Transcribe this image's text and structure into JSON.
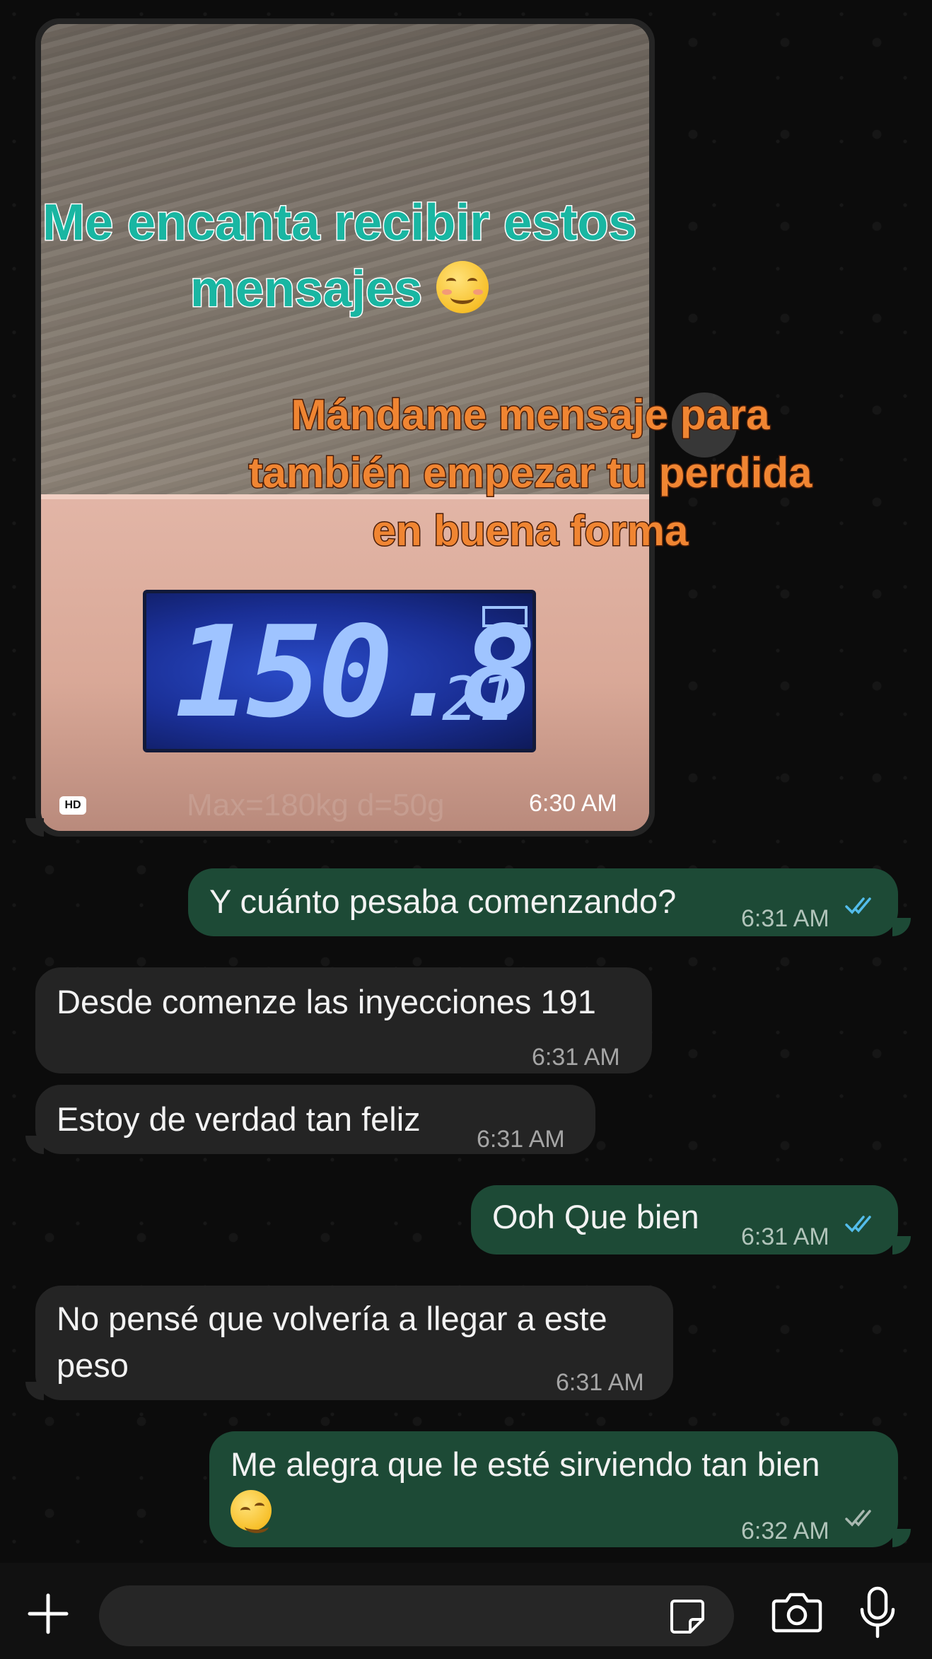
{
  "media_message": {
    "overlay_teal_line1": "Me encanta recibir estos",
    "overlay_teal_line2": "mensajes",
    "overlay_orange_line1": "Mándame mensaje para",
    "overlay_orange_line2": "también empezar tu perdida",
    "overlay_orange_line3": "en buena forma",
    "scale_reading": "150.8",
    "scale_small_reading": "21",
    "scale_label": "Max=180kg d=50g",
    "hd_badge": "HD",
    "time": "6:30 AM"
  },
  "messages": [
    {
      "direction": "out",
      "text": "Y cuánto pesaba comenzando?",
      "time": "6:31 AM",
      "status": "read"
    },
    {
      "direction": "in",
      "text": "Desde comenze las inyecciones 191",
      "time": "6:31 AM"
    },
    {
      "direction": "in",
      "text": "Estoy de verdad tan feliz",
      "time": "6:31 AM"
    },
    {
      "direction": "out",
      "text": "Ooh Que bien",
      "time": "6:31 AM",
      "status": "read"
    },
    {
      "direction": "in",
      "text_line1": "No pensé que volvería a llegar a este",
      "text_line2": "peso",
      "time": "6:31 AM"
    },
    {
      "direction": "out",
      "text_line1": "Me alegra que le esté sirviendo tan bien",
      "time": "6:32 AM",
      "status": "delivered"
    }
  ],
  "input_bar": {
    "add_icon": "plus-icon",
    "sticker_icon": "sticker-icon",
    "camera_icon": "camera-icon",
    "mic_icon": "microphone-icon"
  },
  "colors": {
    "incoming_bubble": "#242424",
    "outgoing_bubble": "#1d4a36",
    "read_ticks": "#53bdeb",
    "delivered_ticks": "#a8b8b0",
    "overlay_teal": "#19b6a2",
    "overlay_orange": "#f08532"
  }
}
